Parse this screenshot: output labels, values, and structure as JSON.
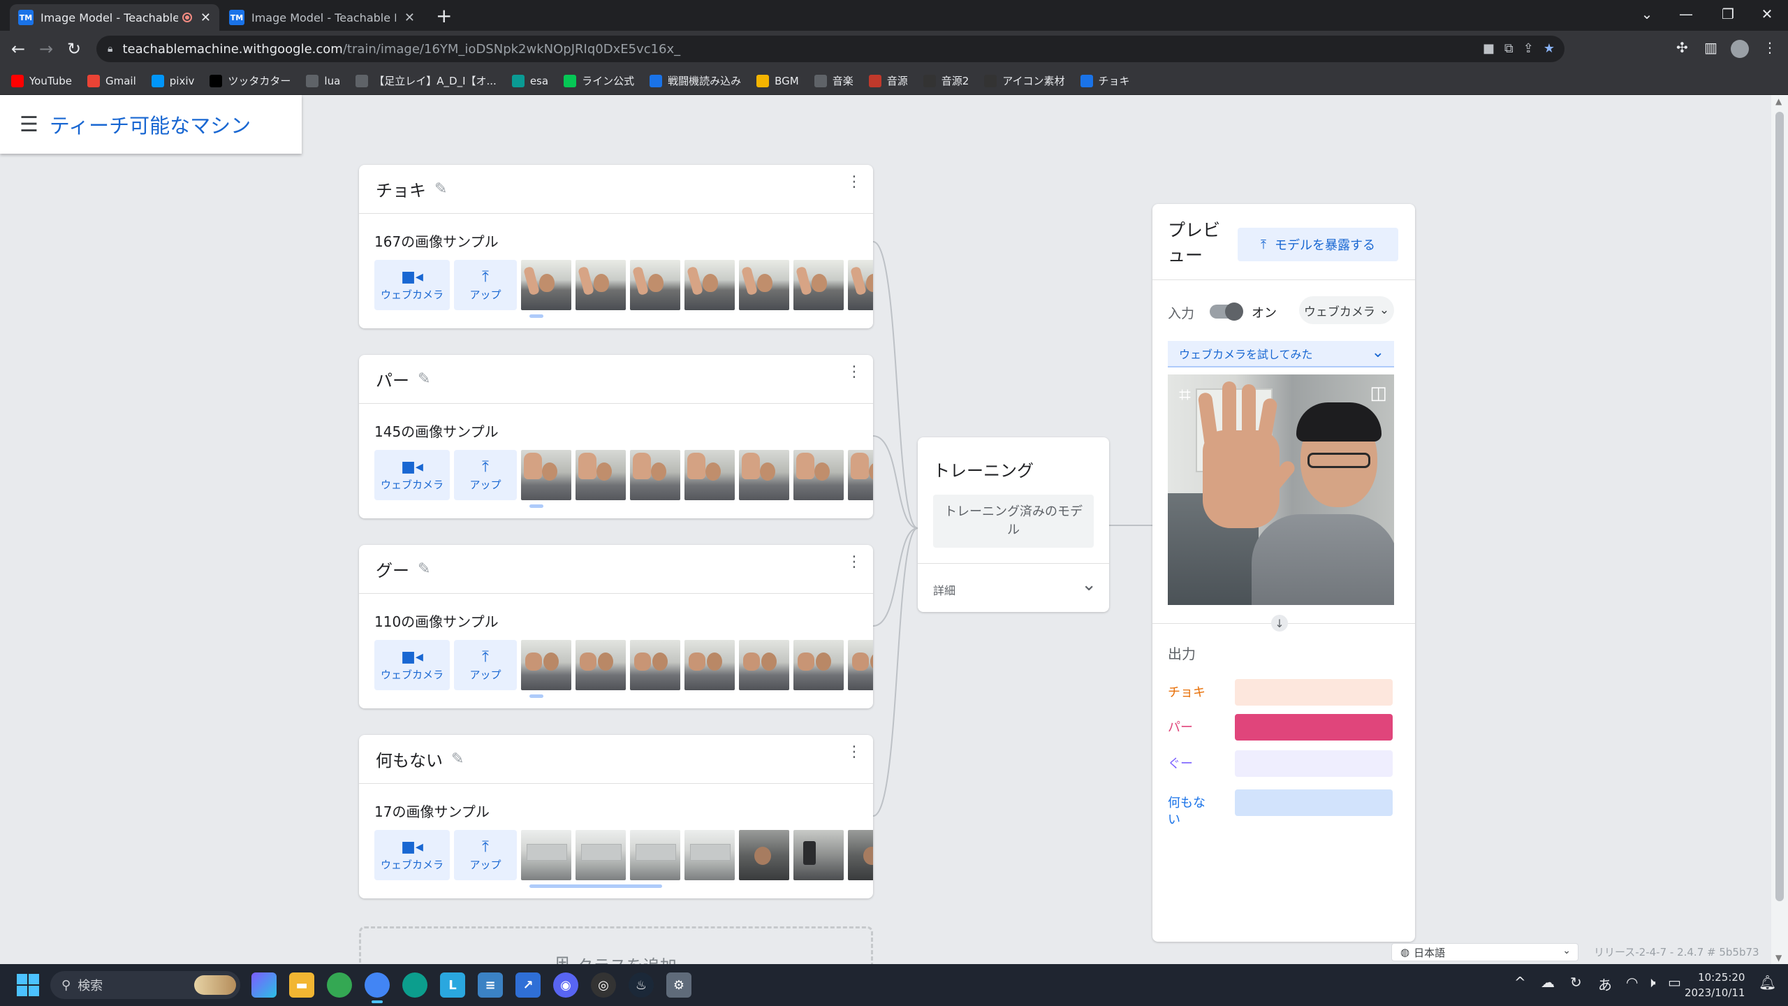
{
  "browser": {
    "tabs": [
      {
        "title": "Image Model - Teachable Machine",
        "favicon": "TM",
        "recording": true,
        "active": true
      },
      {
        "title": "Image Model - Teachable Machine",
        "favicon": "TM",
        "recording": false,
        "active": false
      }
    ],
    "url_host": "teachablemachine.withgoogle.com",
    "url_path": "/train/image/16YM_ioDSNpk2wkNOpJRIq0DxE5vc16x_",
    "bookmarks": [
      {
        "label": "YouTube",
        "icon": "youtube-icon",
        "color": "#ff0000"
      },
      {
        "label": "Gmail",
        "icon": "gmail-icon",
        "color": "#ea4335"
      },
      {
        "label": "pixiv",
        "icon": "pixiv-icon",
        "color": "#0096fa"
      },
      {
        "label": "ツッタカター",
        "icon": "x-icon",
        "color": "#000000"
      },
      {
        "label": "lua",
        "icon": "mail-icon",
        "color": "#5f6368"
      },
      {
        "label": "【足立レイ】A_D_I【オ...",
        "icon": "mail-icon",
        "color": "#5f6368"
      },
      {
        "label": "esa",
        "icon": "esa-icon",
        "color": "#0a9b94"
      },
      {
        "label": "ライン公式",
        "icon": "line-icon",
        "color": "#06c755"
      },
      {
        "label": "戦闘機読み込み",
        "icon": "tm-icon",
        "color": "#1a73e8"
      },
      {
        "label": "BGM",
        "icon": "folder-icon",
        "color": "#f4b400"
      },
      {
        "label": "音楽",
        "icon": "globe-icon",
        "color": "#5f6368"
      },
      {
        "label": "音源",
        "icon": "music-icon",
        "color": "#c0392b"
      },
      {
        "label": "音源2",
        "icon": "music-icon",
        "color": "#333333"
      },
      {
        "label": "アイコン素材",
        "icon": "info-icon",
        "color": "#333333"
      },
      {
        "label": "チョキ",
        "icon": "tm-icon",
        "color": "#1a73e8"
      }
    ]
  },
  "app": {
    "title": "ティーチ可能なマシン"
  },
  "classes": [
    {
      "name": "チョキ",
      "count_text": "167の画像サンプル",
      "thumb": "t-peace",
      "progress": 0.03
    },
    {
      "name": "パー",
      "count_text": "145の画像サンプル",
      "thumb": "t-palm",
      "progress": 0.03
    },
    {
      "name": "グー",
      "count_text": "110の画像サンプル",
      "thumb": "t-fist",
      "progress": 0.04
    },
    {
      "name": "何もない",
      "count_text": "17の画像サンプル",
      "thumb": "t-room",
      "progress": 0.38
    }
  ],
  "sample_buttons": {
    "webcam": "ウェブカメラ",
    "upload": "アップ"
  },
  "add_class": "クラスを追加",
  "training": {
    "title": "トレーニング",
    "button": "トレーニング済みのモデル",
    "advanced": "詳細"
  },
  "preview": {
    "title": "プレビュー",
    "export": "モデルを暴露する",
    "input_label": "入力",
    "toggle_state": "オン",
    "source": "ウェブカメラ",
    "camera": "ウェブカメラを試してみた",
    "output_label": "出力",
    "outputs": [
      {
        "label": "チョキ",
        "color": "#e8710a",
        "track": "#fde7dd",
        "value": 0.0
      },
      {
        "label": "パー",
        "color": "#e0457b",
        "track": "#fbe0e9",
        "value": 1.0
      },
      {
        "label": "ぐー",
        "color": "#7b61ff",
        "track": "#efeefe",
        "value": 0.0
      },
      {
        "label": "何もない",
        "color": "#1a73e8",
        "track": "#d2e3fc",
        "value": 0.0
      }
    ]
  },
  "footer": {
    "language": "日本語",
    "version": "リリース-2-4-7 - 2.4.7 # 5b5b73"
  },
  "taskbar": {
    "search_placeholder": "検索",
    "time": "10:25:20",
    "date": "2023/10/11",
    "ime": "あ"
  }
}
